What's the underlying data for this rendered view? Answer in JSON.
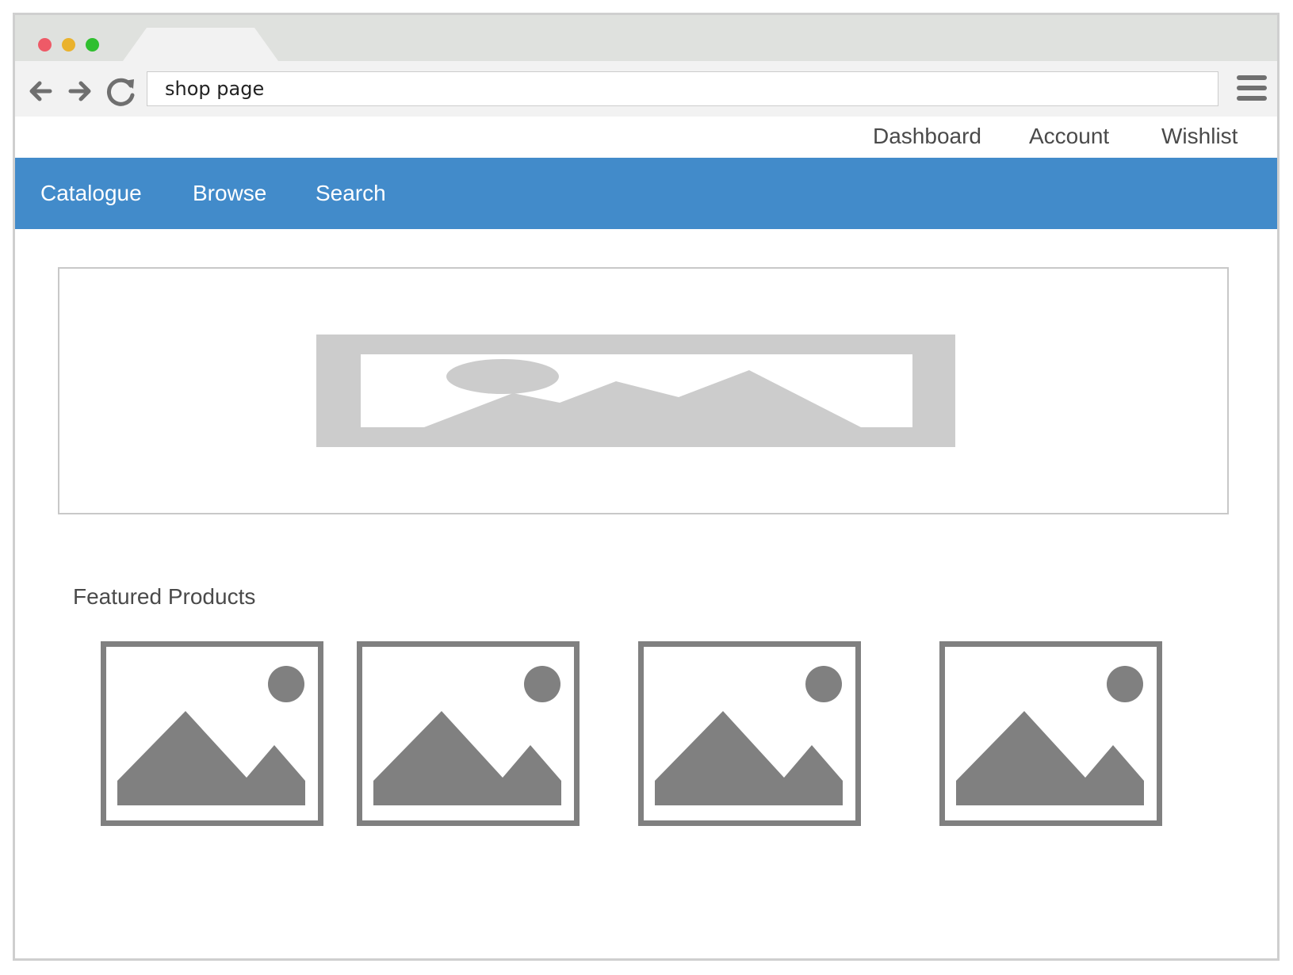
{
  "browser": {
    "window_controls": [
      "close",
      "minimize",
      "maximize"
    ],
    "address_bar": {
      "value": "shop page"
    },
    "nav_icons": [
      "arrow-left-icon",
      "arrow-right-icon",
      "reload-icon",
      "hamburger-menu-icon"
    ]
  },
  "utility_nav": {
    "items": [
      {
        "label": "Dashboard"
      },
      {
        "label": "Account"
      },
      {
        "label": "Wishlist"
      }
    ]
  },
  "main_nav": {
    "background": "#428bca",
    "items": [
      {
        "label": "Catalogue"
      },
      {
        "label": "Browse"
      },
      {
        "label": "Search"
      }
    ]
  },
  "hero": {
    "icon": "image-placeholder-icon",
    "color": "#cccccc"
  },
  "featured": {
    "title": "Featured Products",
    "products": [
      {
        "icon": "image-placeholder-icon"
      },
      {
        "icon": "image-placeholder-icon"
      },
      {
        "icon": "image-placeholder-icon"
      },
      {
        "icon": "image-placeholder-icon"
      }
    ],
    "icon_color": "#808080"
  }
}
